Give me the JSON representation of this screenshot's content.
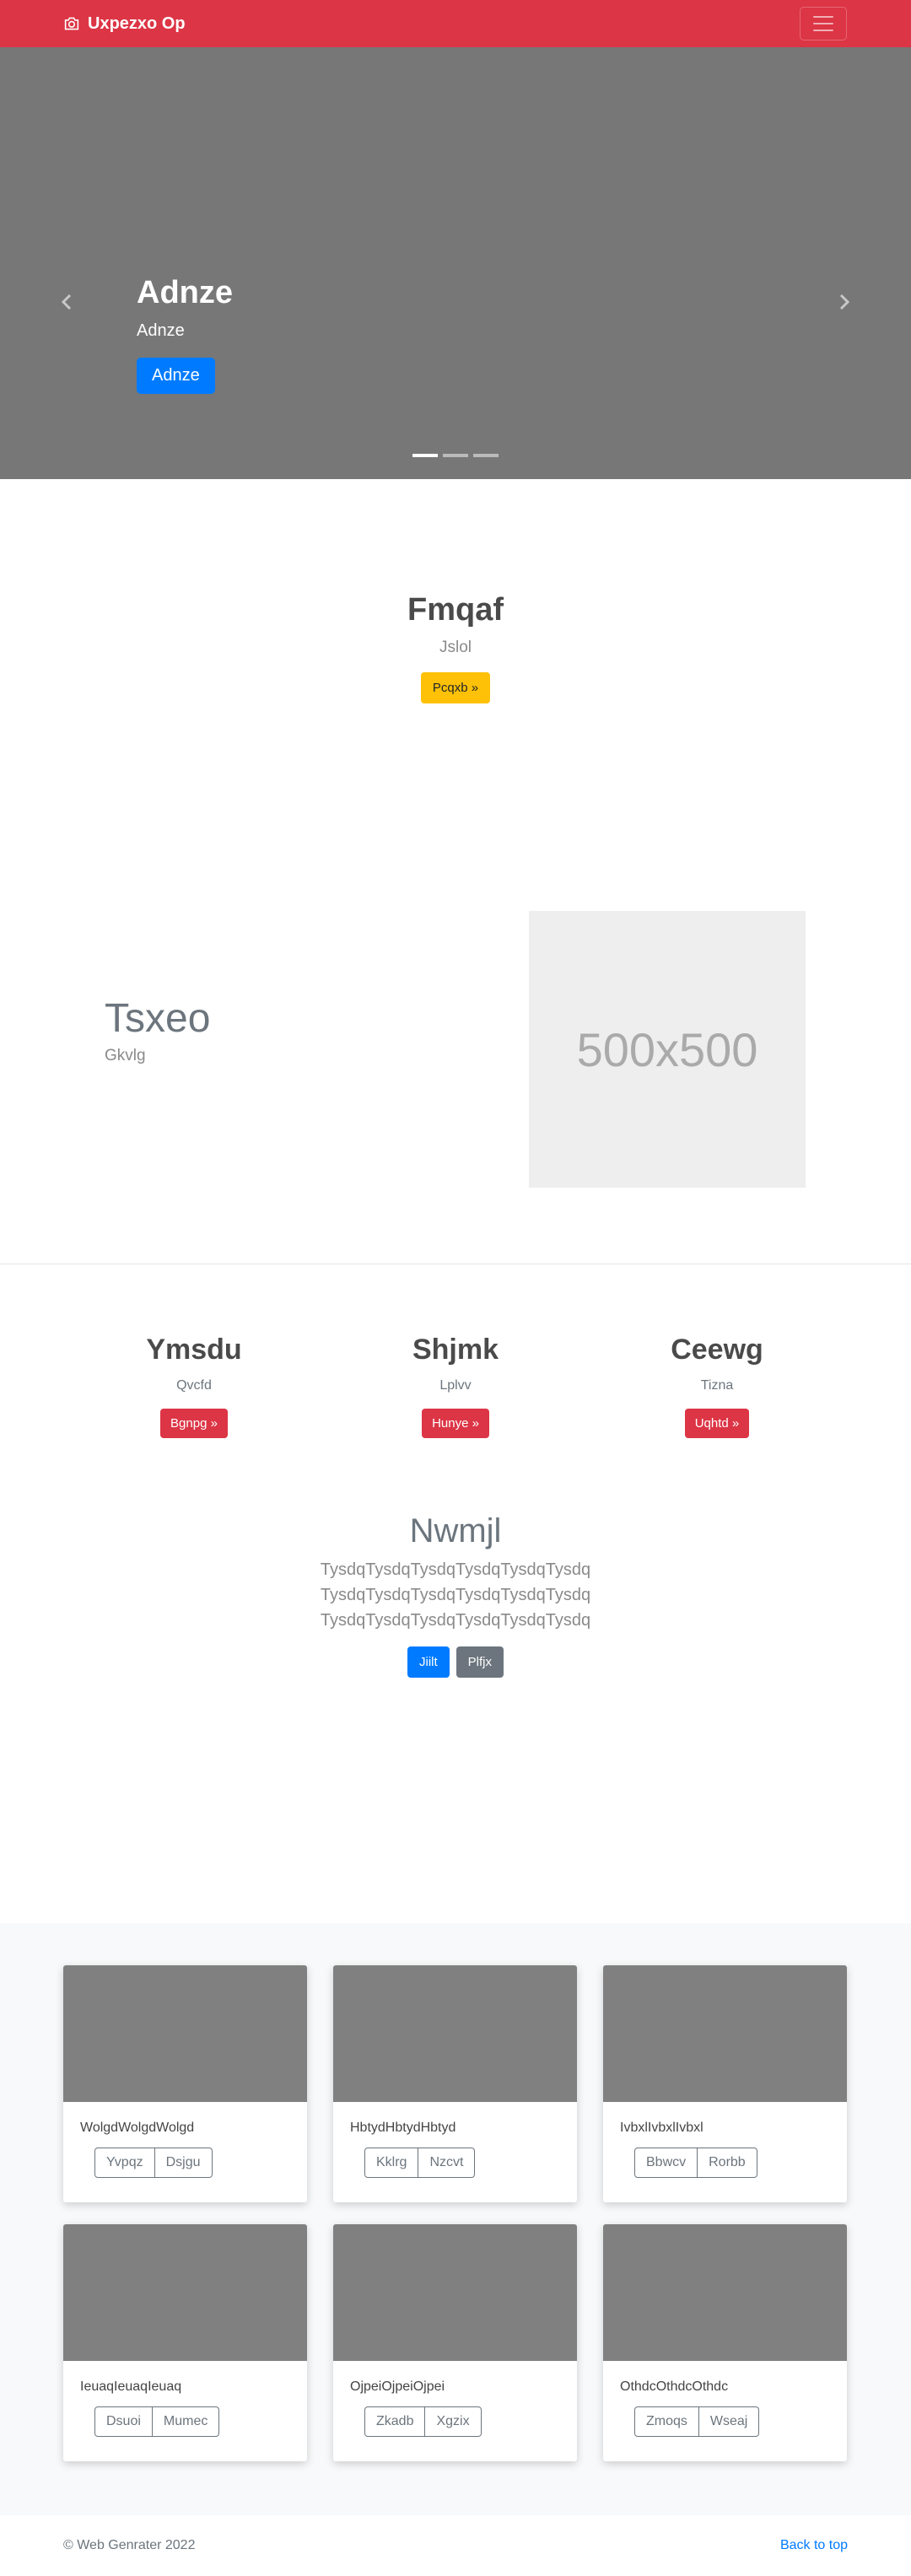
{
  "navbar": {
    "brand": "Uxpezxo Op",
    "brand_icon": "camera-icon",
    "toggler_icon": "hamburger-icon"
  },
  "carousel": {
    "title": "Adnze",
    "subtitle": "Adnze",
    "button": "Adnze",
    "prev_icon": "chevron-left-icon",
    "next_icon": "chevron-right-icon",
    "slide_count": 3,
    "active_slide": 1
  },
  "jumbotron": {
    "title": "Fmqaf",
    "subtitle": "Jslol",
    "button": "Pcqxb »"
  },
  "feature": {
    "title": "Tsxeo",
    "subtitle": "Gkvlg",
    "placeholder": "500x500"
  },
  "columns": [
    {
      "title": "Ymsdu",
      "text": "Qvcfd",
      "button": "Bgnpg »"
    },
    {
      "title": "Shjmk",
      "text": "Lplvv",
      "button": "Hunye »"
    },
    {
      "title": "Ceewg",
      "text": "Tizna",
      "button": "Uqhtd »"
    }
  ],
  "center": {
    "title": "Nwmjl",
    "text": "TysdqTysdqTysdqTysdqTysdqTysdq TysdqTysdqTysdqTysdqTysdqTysdq TysdqTysdqTysdqTysdqTysdqTysdq",
    "primary_button": "Jiilt",
    "secondary_button": "Plfjx"
  },
  "cards": [
    {
      "text": "WolgdWolgdWolgd",
      "btn1": "Yvpqz",
      "btn2": "Dsjgu"
    },
    {
      "text": "HbtydHbtydHbtyd",
      "btn1": "Kklrg",
      "btn2": "Nzcvt"
    },
    {
      "text": "IvbxlIvbxlIvbxl",
      "btn1": "Bbwcv",
      "btn2": "Rorbb"
    },
    {
      "text": "IeuaqIeuaqIeuaq",
      "btn1": "Dsuoi",
      "btn2": "Mumec"
    },
    {
      "text": "OjpeiOjpeiOjpei",
      "btn1": "Zkadb",
      "btn2": "Xgzix"
    },
    {
      "text": "OthdcOthdcOthdc",
      "btn1": "Zmoqs",
      "btn2": "Wseaj"
    }
  ],
  "footer": {
    "copyright": "© Web Genrater 2022",
    "back_to_top": "Back to top"
  },
  "colors": {
    "navbar": "#dc3545",
    "primary": "#007bff",
    "warning": "#ffc107",
    "secondary": "#6c757d",
    "carousel_bg": "#777777"
  }
}
